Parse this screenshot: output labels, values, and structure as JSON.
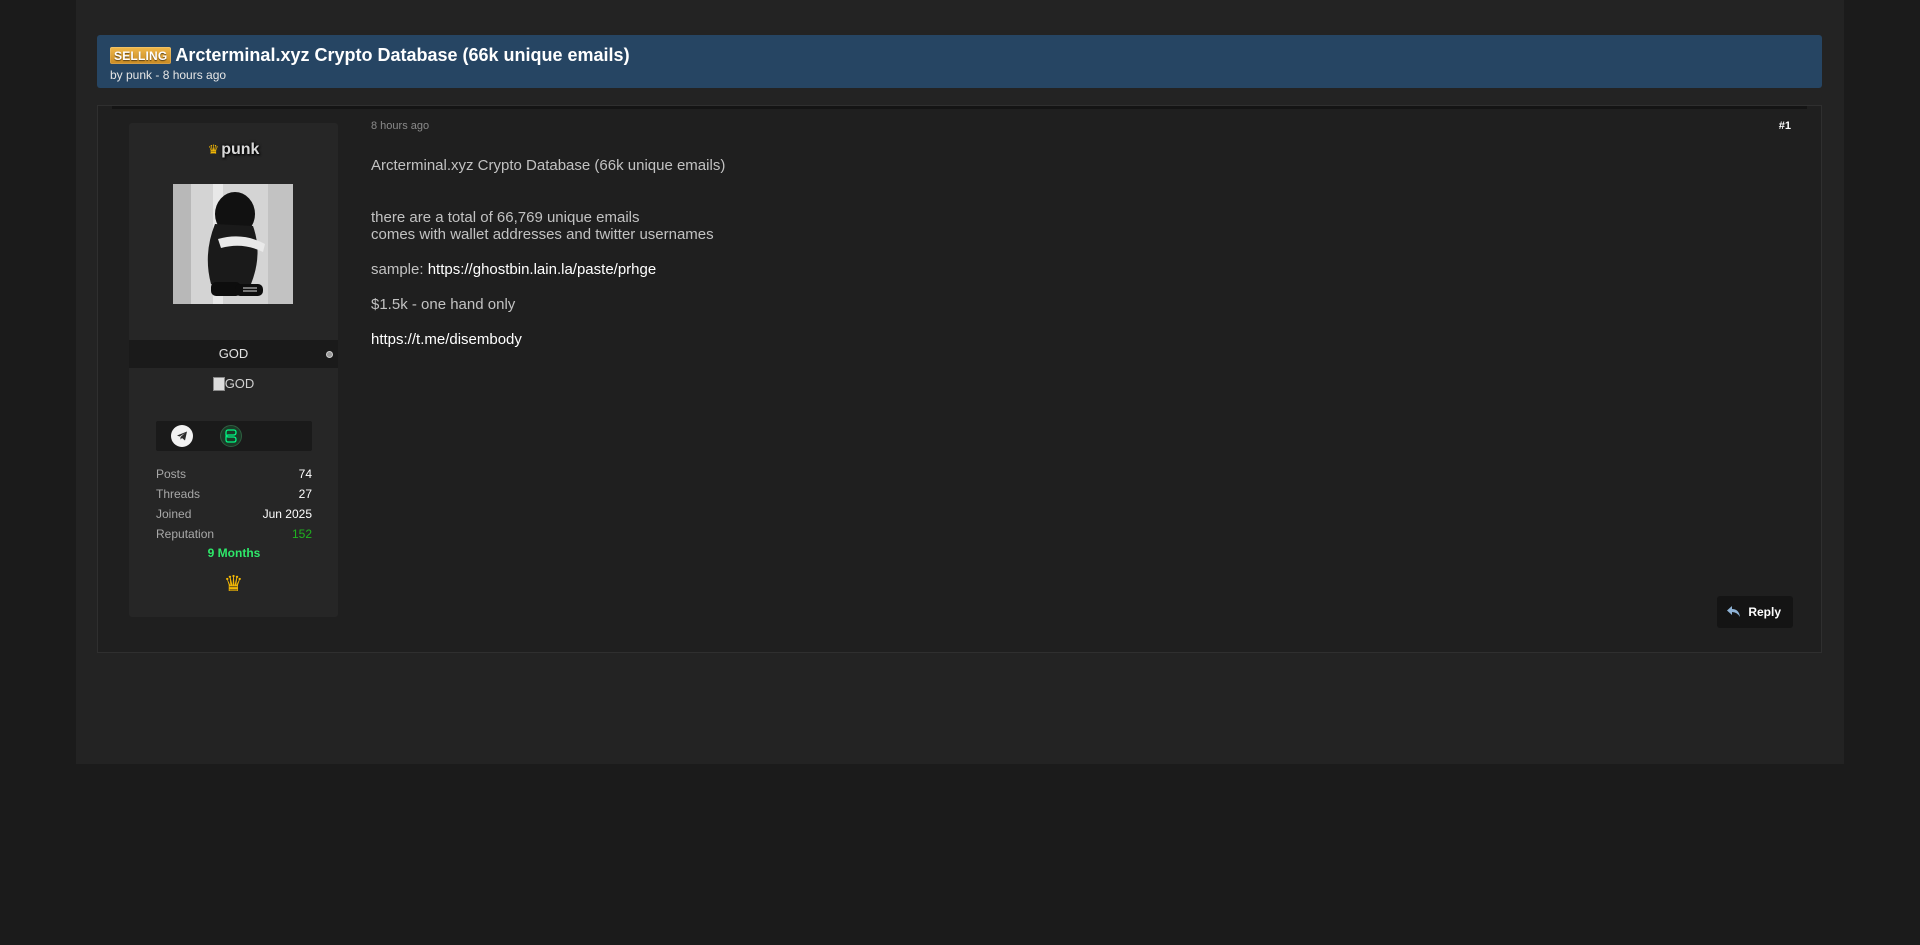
{
  "thread": {
    "prefix": "SELLING",
    "title": "Arcterminal.xyz Crypto Database (66k unique emails)",
    "meta": "by punk - 8 hours ago"
  },
  "author": {
    "username": "punk",
    "rank": "GOD",
    "rank_image_alt": "GOD",
    "online_status": "offline",
    "contacts": [
      "telegram-icon",
      "session-icon"
    ],
    "stats": [
      {
        "label": "Posts",
        "value": "74"
      },
      {
        "label": "Threads",
        "value": "27"
      },
      {
        "label": "Joined",
        "value": "Jun 2025"
      },
      {
        "label": "Reputation",
        "value": "152"
      }
    ],
    "membership": "9 Months",
    "username_crown": "♛",
    "badge_icon": "♛"
  },
  "post": {
    "date": "8 hours ago",
    "number": "#1",
    "line_title": "Arcterminal.xyz Crypto Database (66k unique emails)",
    "line_total": "there are a total of 66,769 unique emails",
    "line_comes": "comes with wallet addresses and twitter usernames",
    "sample_label": "sample:",
    "sample_link": "https://ghostbin.lain.la/paste/prhge",
    "price": "$1.5k - one hand only",
    "contact_link": "https://t.me/disembody"
  },
  "actions": {
    "reply_label": "Reply"
  },
  "colors": {
    "header_bg": "#264563",
    "prefix_badge": "#e0a53a",
    "reputation": "#1fb31f",
    "membership": "#2ee86a",
    "crown": "#f2b705"
  }
}
